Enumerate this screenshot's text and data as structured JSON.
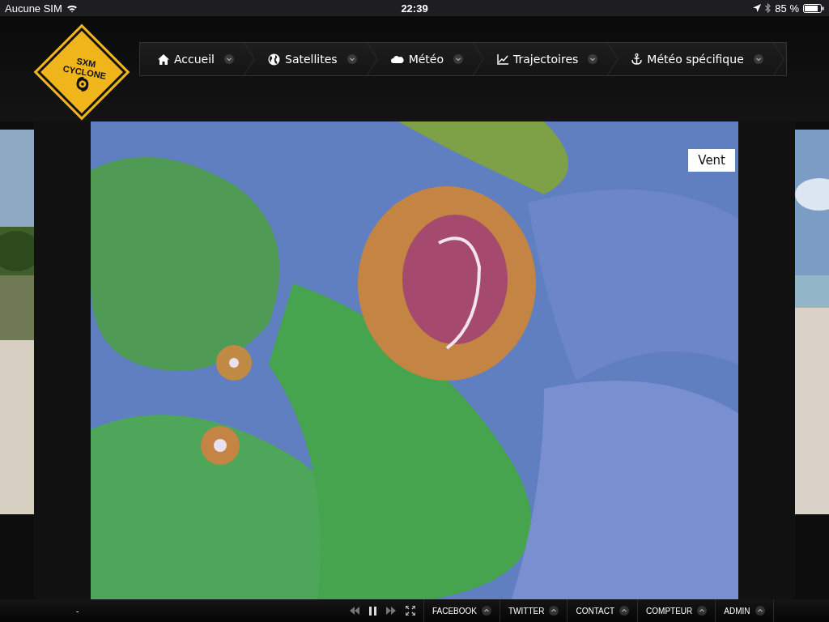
{
  "status_bar": {
    "carrier": "Aucune SIM",
    "time": "22:39",
    "battery": "85 %"
  },
  "logo": {
    "lines": [
      "SXM",
      "CYCLONE"
    ]
  },
  "nav": [
    {
      "label": "Accueil"
    },
    {
      "label": "Satellites"
    },
    {
      "label": "Météo"
    },
    {
      "label": "Trajectoires"
    },
    {
      "label": "Météo spécifique"
    }
  ],
  "map": {
    "kind": "picture",
    "layer_label": "Vent"
  },
  "footer": {
    "text": "-",
    "links": [
      "FACEBOOK",
      "TWITTER",
      "CONTACT",
      "COMPTEUR",
      "ADMIN"
    ]
  }
}
